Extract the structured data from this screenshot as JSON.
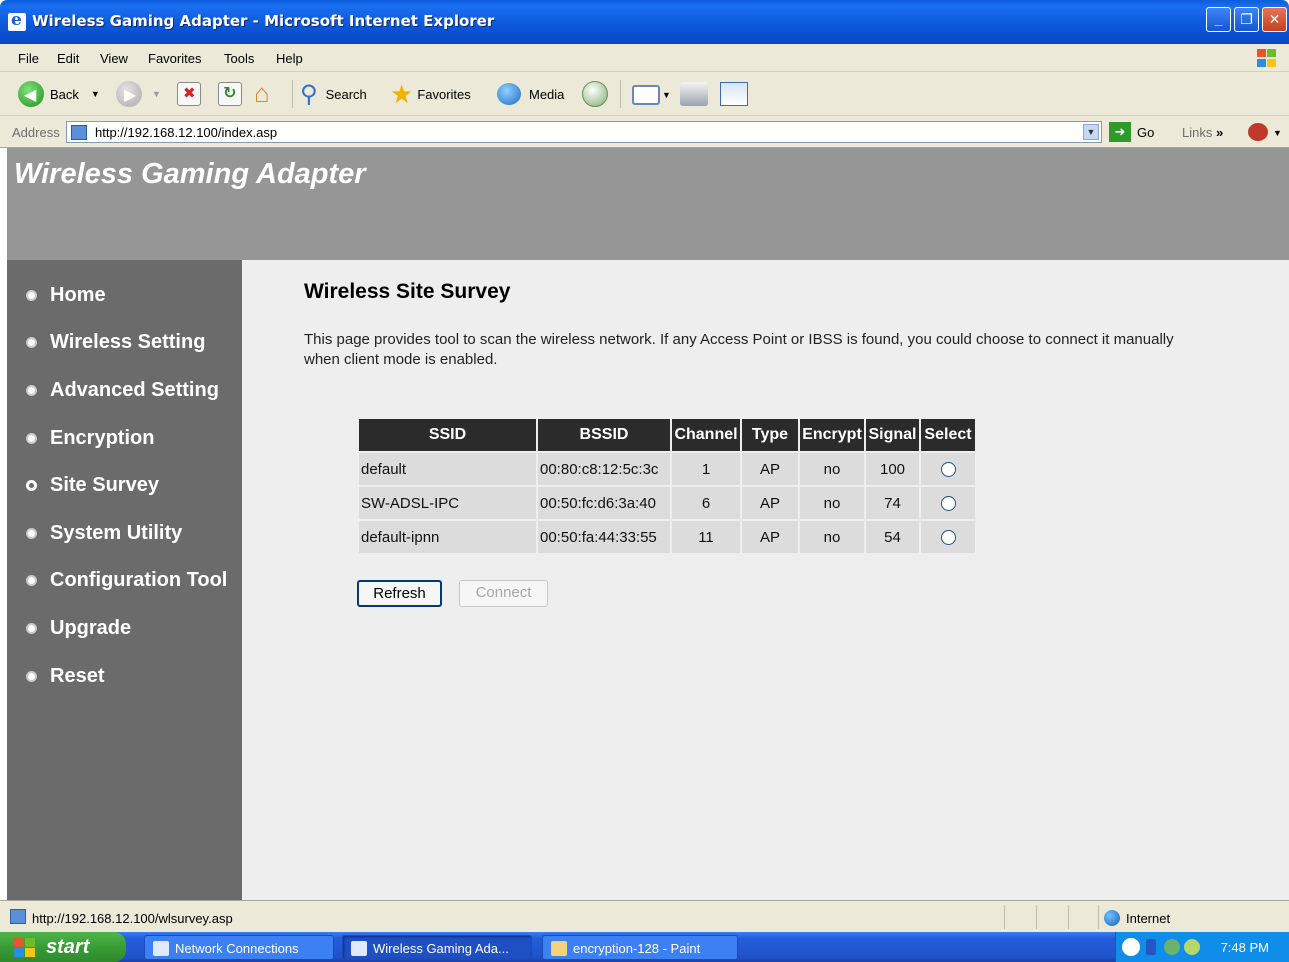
{
  "window": {
    "title": "Wireless Gaming Adapter - Microsoft Internet Explorer",
    "controls": [
      "minimize",
      "maximize",
      "close"
    ]
  },
  "menu": [
    "File",
    "Edit",
    "View",
    "Favorites",
    "Tools",
    "Help"
  ],
  "toolbar": {
    "back": "Back",
    "search": "Search",
    "favorites": "Favorites",
    "media": "Media"
  },
  "address": {
    "label": "Address",
    "url": "http://192.168.12.100/index.asp",
    "go": "Go",
    "links": "Links"
  },
  "page": {
    "banner_title": "Wireless Gaming Adapter",
    "nav": [
      {
        "label": "Home",
        "selected": false
      },
      {
        "label": "Wireless Setting",
        "selected": false
      },
      {
        "label": "Advanced Setting",
        "selected": false
      },
      {
        "label": "Encryption",
        "selected": false
      },
      {
        "label": "Site Survey",
        "selected": true
      },
      {
        "label": "System Utility",
        "selected": false
      },
      {
        "label": "Configuration Tool",
        "selected": false
      },
      {
        "label": "Upgrade",
        "selected": false
      },
      {
        "label": "Reset",
        "selected": false
      }
    ],
    "heading": "Wireless Site Survey",
    "description": "This page provides tool to scan the wireless network. If any Access Point or IBSS is found, you could choose to connect it manually when client mode is enabled.",
    "table": {
      "headers": [
        "SSID",
        "BSSID",
        "Channel",
        "Type",
        "Encrypt",
        "Signal",
        "Select"
      ],
      "rows": [
        {
          "ssid": "default",
          "bssid": "00:80:c8:12:5c:3c",
          "channel": "1",
          "type": "AP",
          "encrypt": "no",
          "signal": "100"
        },
        {
          "ssid": "SW-ADSL-IPC",
          "bssid": "00:50:fc:d6:3a:40",
          "channel": "6",
          "type": "AP",
          "encrypt": "no",
          "signal": "74"
        },
        {
          "ssid": "default-ipnn",
          "bssid": "00:50:fa:44:33:55",
          "channel": "11",
          "type": "AP",
          "encrypt": "no",
          "signal": "54"
        }
      ]
    },
    "buttons": {
      "refresh": "Refresh",
      "connect": "Connect"
    }
  },
  "status": {
    "url": "http://192.168.12.100/wlsurvey.asp",
    "zone": "Internet"
  },
  "taskbar": {
    "start": "start",
    "tasks": [
      {
        "label": "Network Connections",
        "active": false
      },
      {
        "label": "Wireless Gaming Ada...",
        "active": true
      },
      {
        "label": "encryption-128 - Paint",
        "active": false
      }
    ],
    "time": "7:48 PM"
  }
}
